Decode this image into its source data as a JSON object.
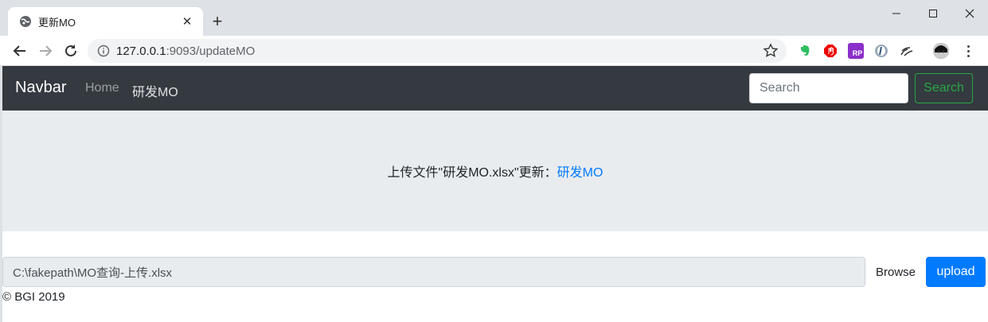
{
  "browser": {
    "tab_title": "更新MO",
    "url_host": "127.0.0.1",
    "url_path": ":9093/updateMO"
  },
  "navbar": {
    "brand": "Navbar",
    "links": [
      "Home",
      "研发MO"
    ],
    "search_placeholder": "Search",
    "search_button": "Search"
  },
  "jumbotron": {
    "message": "上传文件\"研发MO.xlsx\"更新：",
    "link_text": "研发MO"
  },
  "upload": {
    "file_path": "C:\\fakepath\\MO查询-上传.xlsx",
    "browse_label": "Browse",
    "upload_label": "upload"
  },
  "footer": {
    "text": "© BGI 2019"
  },
  "colors": {
    "navbar_bg": "#343a40",
    "primary": "#007bff",
    "success": "#28a745",
    "jumbotron_bg": "#e9ecef"
  }
}
